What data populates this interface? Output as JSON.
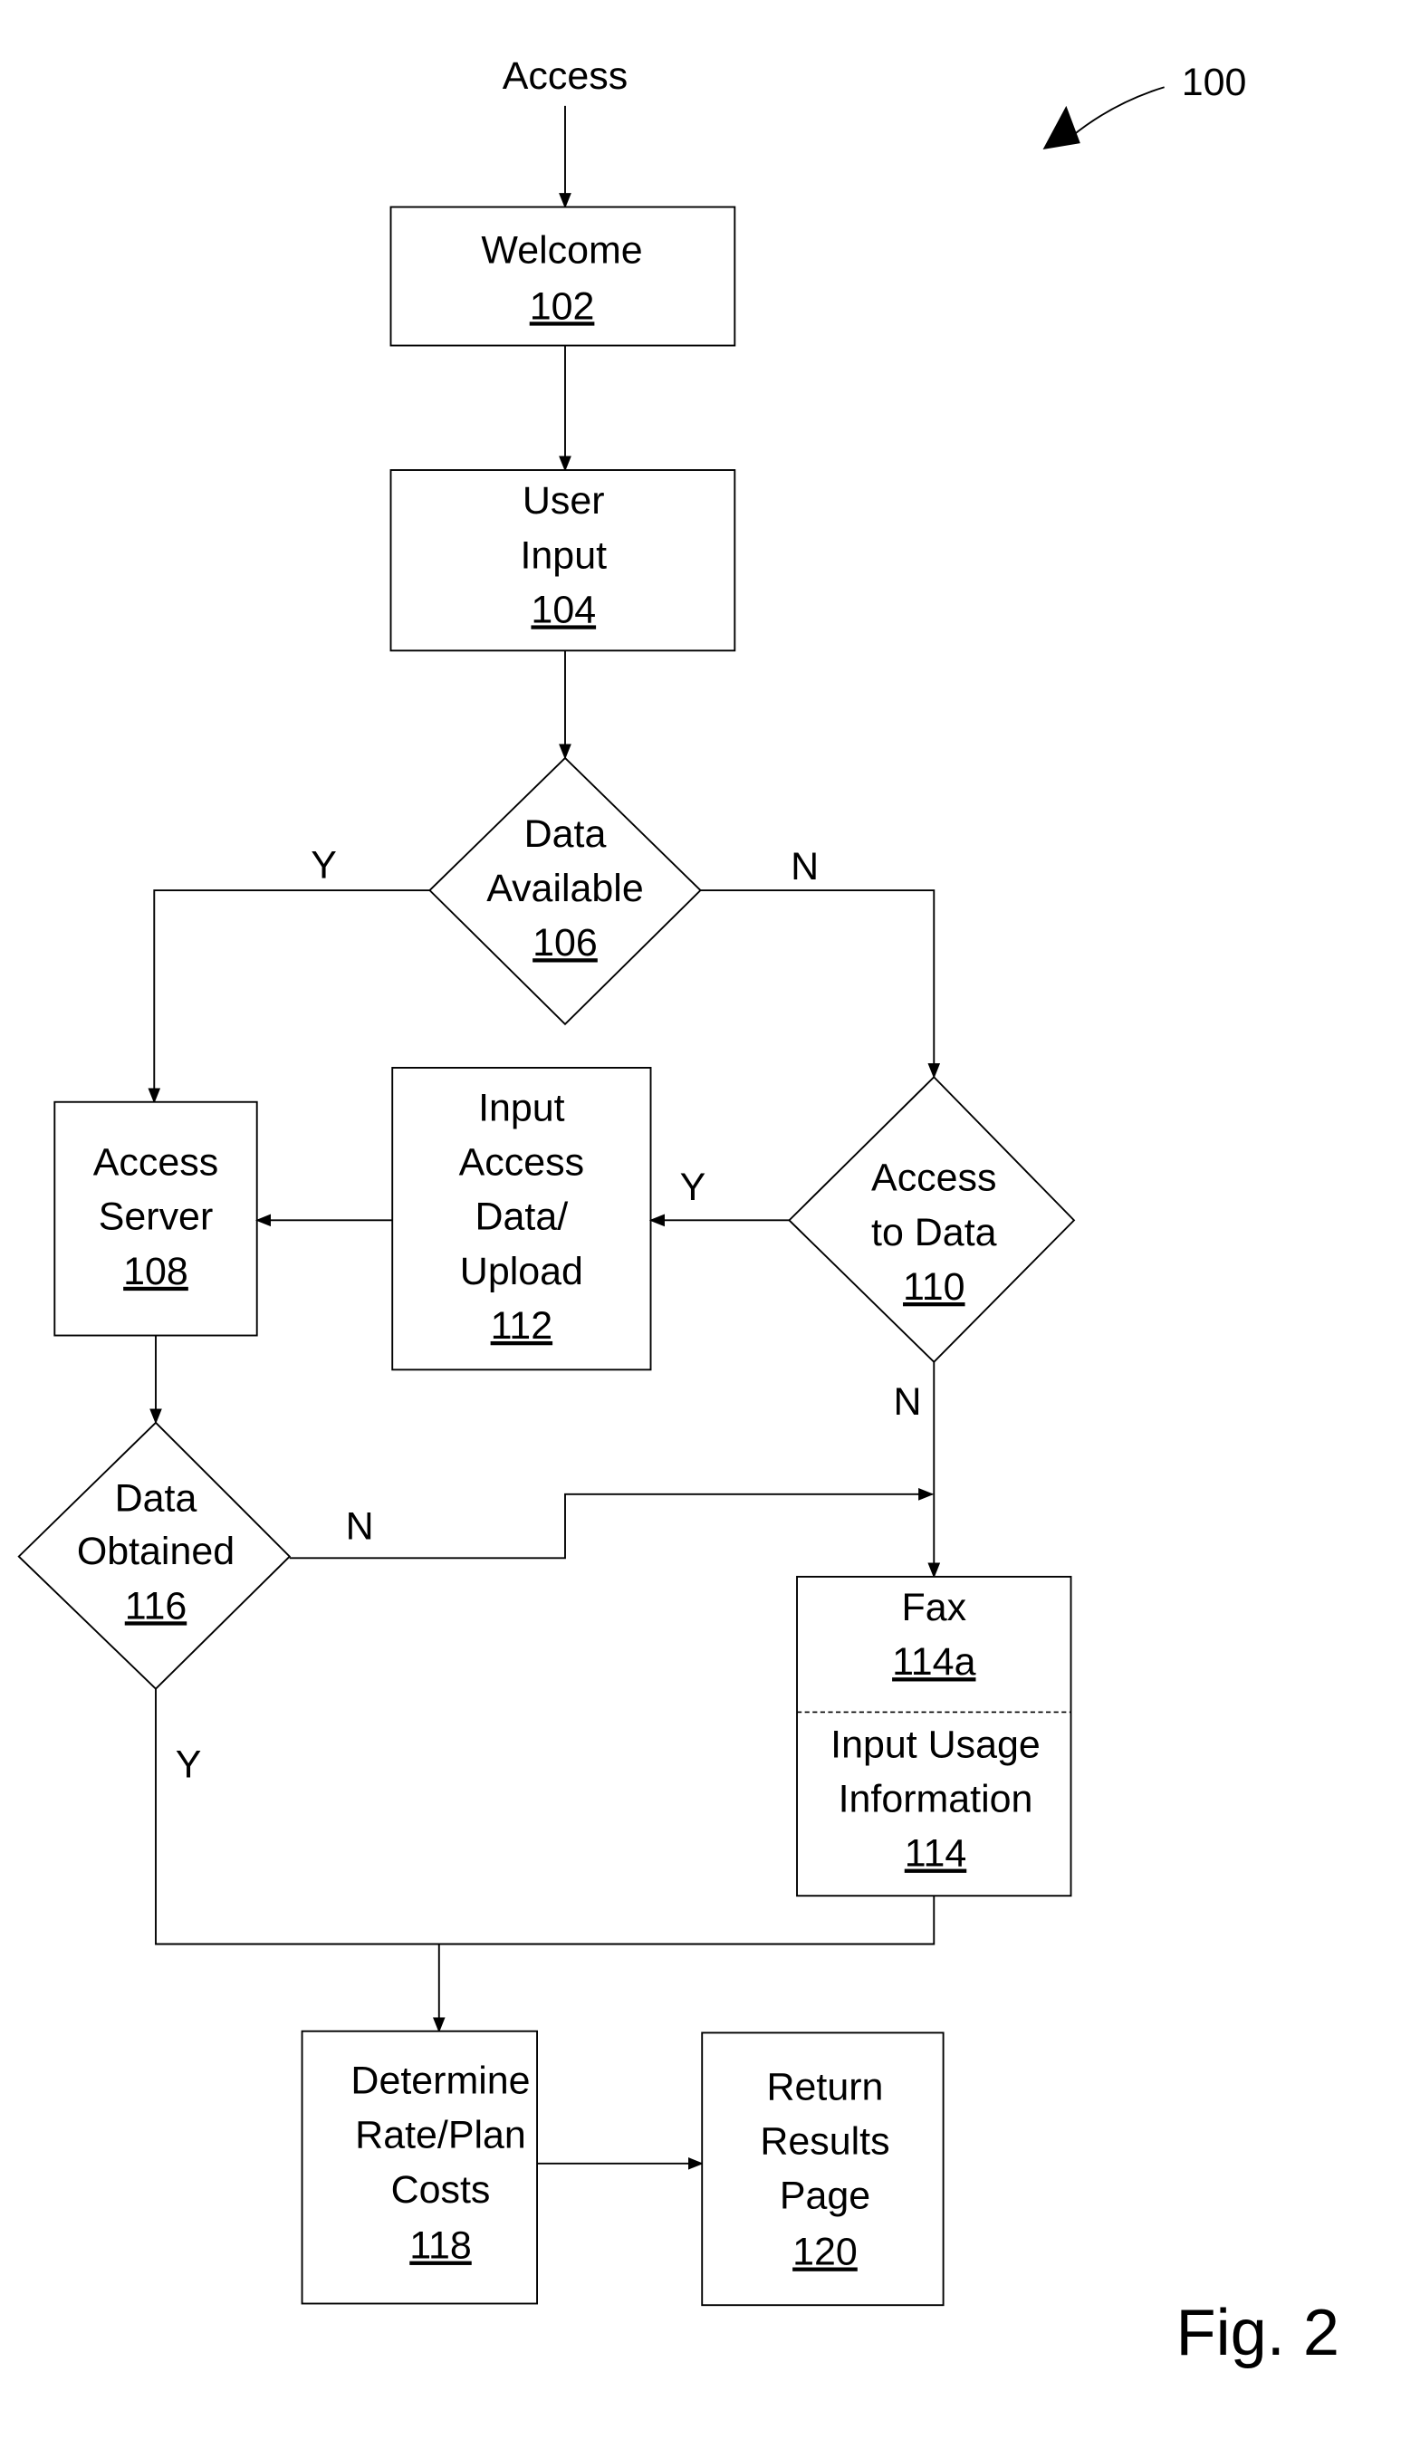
{
  "figure": {
    "reference_number": "100",
    "caption": "Fig. 2",
    "entry_label": "Access"
  },
  "nodes": {
    "welcome": {
      "lines": [
        "Welcome"
      ],
      "ref": "102",
      "shape": "process"
    },
    "user_input": {
      "lines": [
        "User",
        "Input"
      ],
      "ref": "104",
      "shape": "process"
    },
    "data_available": {
      "lines": [
        "Data",
        "Available"
      ],
      "ref": "106",
      "shape": "decision"
    },
    "access_server": {
      "lines": [
        "Access",
        "Server"
      ],
      "ref": "108",
      "shape": "process"
    },
    "input_access_data": {
      "lines": [
        "Input",
        "Access",
        "Data/",
        "Upload"
      ],
      "ref": "112",
      "shape": "process"
    },
    "access_to_data": {
      "lines": [
        "Access",
        "to Data"
      ],
      "ref": "110",
      "shape": "decision"
    },
    "data_obtained": {
      "lines": [
        "Data",
        "Obtained"
      ],
      "ref": "116",
      "shape": "decision"
    },
    "fax": {
      "lines": [
        "Fax"
      ],
      "ref": "114a",
      "shape": "process"
    },
    "input_usage": {
      "lines": [
        "Input Usage",
        "Information"
      ],
      "ref": "114",
      "shape": "process"
    },
    "determine_costs": {
      "lines": [
        "Determine",
        "Rate/Plan",
        "Costs"
      ],
      "ref": "118",
      "shape": "process"
    },
    "return_results": {
      "lines": [
        "Return",
        "Results",
        "Page"
      ],
      "ref": "120",
      "shape": "process"
    }
  },
  "edge_labels": {
    "data_available_yes": "Y",
    "data_available_no": "N",
    "access_to_data_yes": "Y",
    "access_to_data_no": "N",
    "data_obtained_no": "N",
    "data_obtained_yes": "Y"
  },
  "edges": [
    {
      "from": "Access",
      "to": "welcome"
    },
    {
      "from": "welcome",
      "to": "user_input"
    },
    {
      "from": "user_input",
      "to": "data_available"
    },
    {
      "from": "data_available",
      "to": "access_server",
      "label": "Y"
    },
    {
      "from": "data_available",
      "to": "access_to_data",
      "label": "N"
    },
    {
      "from": "access_to_data",
      "to": "input_access_data",
      "label": "Y"
    },
    {
      "from": "input_access_data",
      "to": "access_server"
    },
    {
      "from": "access_to_data",
      "to": "fax",
      "label": "N"
    },
    {
      "from": "access_server",
      "to": "data_obtained"
    },
    {
      "from": "data_obtained",
      "to": "fax",
      "label": "N"
    },
    {
      "from": "data_obtained",
      "to": "determine_costs",
      "label": "Y"
    },
    {
      "from": "input_usage",
      "to": "determine_costs"
    },
    {
      "from": "determine_costs",
      "to": "return_results"
    }
  ]
}
